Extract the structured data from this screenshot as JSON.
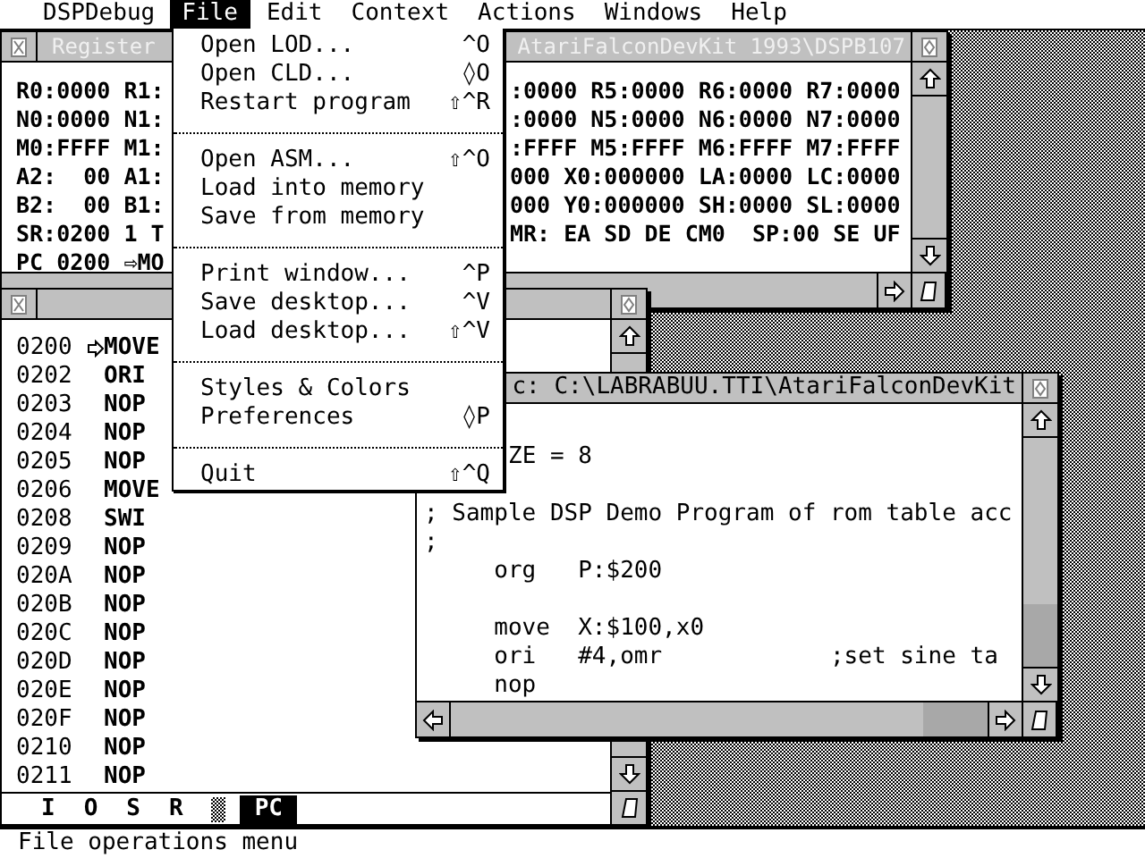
{
  "menu_bar": {
    "app": "DSPDebug",
    "items": [
      {
        "label": "File",
        "selected": true
      },
      {
        "label": "Edit",
        "selected": false
      },
      {
        "label": "Context",
        "selected": false
      },
      {
        "label": "Actions",
        "selected": false
      },
      {
        "label": "Windows",
        "selected": false
      },
      {
        "label": "Help",
        "selected": false
      }
    ]
  },
  "file_menu": {
    "items": [
      {
        "kind": "item",
        "label": "Open LOD...",
        "shortcut": "^O"
      },
      {
        "kind": "item",
        "label": "Open CLD...",
        "shortcut": "◊O"
      },
      {
        "kind": "item",
        "label": "Restart program",
        "shortcut": "⇧^R"
      },
      {
        "kind": "separator"
      },
      {
        "kind": "item",
        "label": "Open ASM...",
        "shortcut": "⇧^O"
      },
      {
        "kind": "item",
        "label": "Load into memory"
      },
      {
        "kind": "item",
        "label": "Save from memory"
      },
      {
        "kind": "separator"
      },
      {
        "kind": "item",
        "label": "Print window...",
        "shortcut": "^P"
      },
      {
        "kind": "item",
        "label": "Save desktop...",
        "shortcut": "^V"
      },
      {
        "kind": "item",
        "label": "Load desktop...",
        "shortcut": "⇧^V"
      },
      {
        "kind": "separator"
      },
      {
        "kind": "item",
        "label": "Styles & Colors"
      },
      {
        "kind": "item",
        "label": "Preferences",
        "shortcut": "◊P"
      },
      {
        "kind": "separator"
      },
      {
        "kind": "item",
        "label": "Quit",
        "shortcut": "⇧^Q"
      }
    ]
  },
  "windows": [
    {
      "kind": "registers",
      "active": false,
      "title_left": "Register",
      "title_right": "AtariFalconDevKit 1993\\DSPB107",
      "rows": [
        {
          "left": "R0:0000 R1:",
          "right": ":0000 R5:0000 R6:0000 R7:0000"
        },
        {
          "left": "N0:0000 N1:",
          "right": ":0000 N5:0000 N6:0000 N7:0000"
        },
        {
          "left": "M0:FFFF M1:",
          "right": ":FFFF M5:FFFF M6:FFFF M7:FFFF"
        },
        {
          "left": "A2:  00 A1:",
          "right": "000 X0:000000 LA:0000 LC:0000"
        },
        {
          "left": "B2:  00 B1:",
          "right": "000 Y0:000000 SH:0000 SL:0000"
        },
        {
          "left": "SR:0200 1 T",
          "right": "MR: EA SD DE CM0  SP:00 SE UF"
        },
        {
          "left": "PC 0200 ⇨MO"
        }
      ]
    },
    {
      "kind": "disassembly",
      "lines": [
        {
          "address": "0200",
          "mnemonic": "MOVE",
          "current": true
        },
        {
          "address": "0202",
          "mnemonic": "ORI",
          "current": false
        },
        {
          "address": "0203",
          "mnemonic": "NOP",
          "current": false
        },
        {
          "address": "0204",
          "mnemonic": "NOP",
          "current": false
        },
        {
          "address": "0205",
          "mnemonic": "NOP",
          "current": false
        },
        {
          "address": "0206",
          "mnemonic": "MOVE",
          "current": false
        },
        {
          "address": "0208",
          "mnemonic": "SWI",
          "current": false
        },
        {
          "address": "0209",
          "mnemonic": "NOP",
          "current": false
        },
        {
          "address": "020A",
          "mnemonic": "NOP",
          "current": false
        },
        {
          "address": "020B",
          "mnemonic": "NOP",
          "current": false
        },
        {
          "address": "020C",
          "mnemonic": "NOP",
          "current": false
        },
        {
          "address": "020D",
          "mnemonic": "NOP",
          "current": false
        },
        {
          "address": "020E",
          "mnemonic": "NOP",
          "current": false
        },
        {
          "address": "020F",
          "mnemonic": "NOP",
          "current": false
        },
        {
          "address": "0210",
          "mnemonic": "NOP",
          "current": false
        },
        {
          "address": "0211",
          "mnemonic": "NOP",
          "current": false
        }
      ],
      "tabs": [
        {
          "kind": "text",
          "label": "I",
          "selected": false
        },
        {
          "kind": "text",
          "label": "O",
          "selected": false
        },
        {
          "kind": "text",
          "label": "S",
          "selected": false
        },
        {
          "kind": "text",
          "label": "R",
          "selected": false
        },
        {
          "kind": "pattern",
          "selected": false
        },
        {
          "kind": "text",
          "label": "PC",
          "selected": true
        }
      ]
    },
    {
      "kind": "source",
      "active": true,
      "title": "c: C:\\LABRABUU.TTI\\AtariFalconDevKit",
      "partial_line": "ZE = 8",
      "lines": [
        {
          "kind": "blank"
        },
        {
          "kind": "code",
          "text": "; Sample DSP Demo Program of rom table acc"
        },
        {
          "kind": "code",
          "text": ";"
        },
        {
          "kind": "code",
          "text": "     org   P:$200"
        },
        {
          "kind": "blank"
        },
        {
          "kind": "code",
          "text": "     move  X:$100,x0"
        },
        {
          "kind": "code",
          "text": "     ori   #4,omr            ;set sine ta"
        },
        {
          "kind": "code",
          "text": "     nop"
        }
      ]
    }
  ],
  "status_bar": {
    "text": "File operations menu"
  }
}
